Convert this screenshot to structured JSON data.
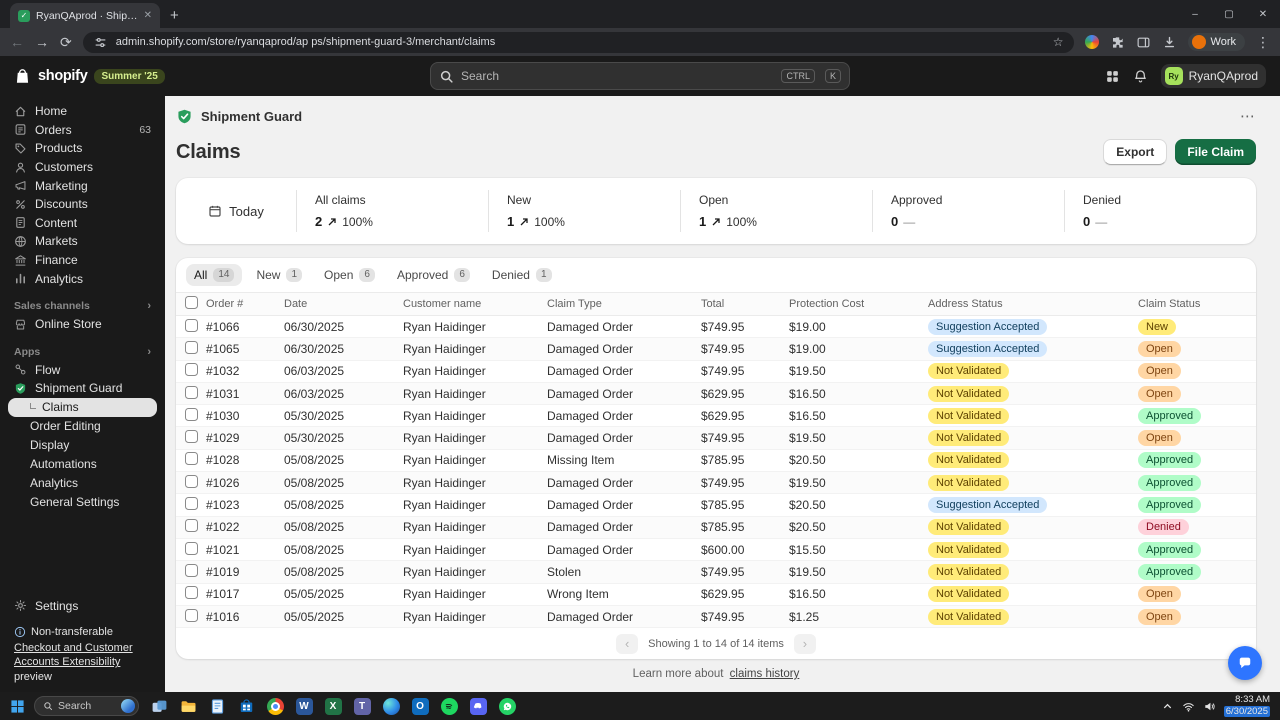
{
  "colors": {
    "brand-green": "#2a9d5c",
    "button-green": "#166e44",
    "badge-blue-bg": "#d2e7fd",
    "badge-blue-text": "#12405e",
    "badge-yellow-bg": "#ffeb79",
    "badge-yellow-text": "#5e4200",
    "badge-orange-bg": "#ffd6a4",
    "badge-orange-text": "#7e4410",
    "badge-green-bg": "#b0fcc8",
    "badge-green-text": "#0c5132",
    "badge-red-bg": "#fed1da",
    "badge-red-text": "#8e0b21",
    "chat-blue": "#2e75ff"
  },
  "browser": {
    "tab_title": "RyanQAprod · Shipment Guard",
    "url": "admin.shopify.com/store/ryanqaprod/ap ps/shipment-guard-3/merchant/claims",
    "profile_label": "Work"
  },
  "topbar": {
    "wordmark": "shopify",
    "edition_badge": "Summer '25",
    "search_placeholder": "Search",
    "shortcut_keys": [
      "CTRL",
      "K"
    ],
    "avatar_initials": "Ry",
    "account_name": "RyanQAprod"
  },
  "sidebar": {
    "items": [
      {
        "label": "Home",
        "icon": "home-icon"
      },
      {
        "label": "Orders",
        "icon": "orders-icon",
        "badge": "63"
      },
      {
        "label": "Products",
        "icon": "products-icon"
      },
      {
        "label": "Customers",
        "icon": "customers-icon"
      },
      {
        "label": "Marketing",
        "icon": "marketing-icon"
      },
      {
        "label": "Discounts",
        "icon": "discounts-icon"
      },
      {
        "label": "Content",
        "icon": "content-icon"
      },
      {
        "label": "Markets",
        "icon": "markets-icon"
      },
      {
        "label": "Finance",
        "icon": "finance-icon"
      },
      {
        "label": "Analytics",
        "icon": "analytics-icon"
      }
    ],
    "sales_channels_header": "Sales channels",
    "sales_channel_items": [
      {
        "label": "Online Store",
        "icon": "online-store-icon"
      }
    ],
    "apps_header": "Apps",
    "app_items": [
      {
        "label": "Flow",
        "icon": "flow-icon"
      },
      {
        "label": "Shipment Guard",
        "icon": "shipment-guard-icon",
        "children": [
          {
            "label": "Claims",
            "active": true
          },
          {
            "label": "Order Editing"
          },
          {
            "label": "Display"
          },
          {
            "label": "Automations"
          },
          {
            "label": "Analytics"
          },
          {
            "label": "General Settings"
          }
        ]
      }
    ],
    "settings_label": "Settings",
    "notice": {
      "title": "Non-transferable",
      "link_text": "Checkout and Customer Accounts Extensibility",
      "suffix": "preview"
    }
  },
  "main": {
    "app_title": "Shipment Guard",
    "page_title": "Claims",
    "export_button": "Export",
    "file_claim_button": "File Claim",
    "date_filter": "Today",
    "stats": [
      {
        "label": "All claims",
        "value": "2",
        "change": "100%",
        "trend": "up"
      },
      {
        "label": "New",
        "value": "1",
        "change": "100%",
        "trend": "up"
      },
      {
        "label": "Open",
        "value": "1",
        "change": "100%",
        "trend": "up"
      },
      {
        "label": "Approved",
        "value": "0",
        "change": "—",
        "trend": "flat"
      },
      {
        "label": "Denied",
        "value": "0",
        "change": "—",
        "trend": "flat"
      }
    ],
    "filter_tabs": [
      {
        "label": "All",
        "count": "14",
        "active": true
      },
      {
        "label": "New",
        "count": "1"
      },
      {
        "label": "Open",
        "count": "6"
      },
      {
        "label": "Approved",
        "count": "6"
      },
      {
        "label": "Denied",
        "count": "1"
      }
    ],
    "table": {
      "columns": [
        "Order #",
        "Date",
        "Customer name",
        "Claim Type",
        "Total",
        "Protection Cost",
        "Address Status",
        "Claim Status"
      ],
      "rows": [
        {
          "order": "#1066",
          "date": "06/30/2025",
          "customer": "Ryan Haidinger",
          "claim_type": "Damaged Order",
          "total": "$749.95",
          "protection_cost": "$19.00",
          "address_status": "Suggestion Accepted",
          "claim_status": "New"
        },
        {
          "order": "#1065",
          "date": "06/30/2025",
          "customer": "Ryan Haidinger",
          "claim_type": "Damaged Order",
          "total": "$749.95",
          "protection_cost": "$19.00",
          "address_status": "Suggestion Accepted",
          "claim_status": "Open"
        },
        {
          "order": "#1032",
          "date": "06/03/2025",
          "customer": "Ryan Haidinger",
          "claim_type": "Damaged Order",
          "total": "$749.95",
          "protection_cost": "$19.50",
          "address_status": "Not Validated",
          "claim_status": "Open"
        },
        {
          "order": "#1031",
          "date": "06/03/2025",
          "customer": "Ryan Haidinger",
          "claim_type": "Damaged Order",
          "total": "$629.95",
          "protection_cost": "$16.50",
          "address_status": "Not Validated",
          "claim_status": "Open"
        },
        {
          "order": "#1030",
          "date": "05/30/2025",
          "customer": "Ryan Haidinger",
          "claim_type": "Damaged Order",
          "total": "$629.95",
          "protection_cost": "$16.50",
          "address_status": "Not Validated",
          "claim_status": "Approved"
        },
        {
          "order": "#1029",
          "date": "05/30/2025",
          "customer": "Ryan Haidinger",
          "claim_type": "Damaged Order",
          "total": "$749.95",
          "protection_cost": "$19.50",
          "address_status": "Not Validated",
          "claim_status": "Open"
        },
        {
          "order": "#1028",
          "date": "05/08/2025",
          "customer": "Ryan Haidinger",
          "claim_type": "Missing Item",
          "total": "$785.95",
          "protection_cost": "$20.50",
          "address_status": "Not Validated",
          "claim_status": "Approved"
        },
        {
          "order": "#1026",
          "date": "05/08/2025",
          "customer": "Ryan Haidinger",
          "claim_type": "Damaged Order",
          "total": "$749.95",
          "protection_cost": "$19.50",
          "address_status": "Not Validated",
          "claim_status": "Approved"
        },
        {
          "order": "#1023",
          "date": "05/08/2025",
          "customer": "Ryan Haidinger",
          "claim_type": "Damaged Order",
          "total": "$785.95",
          "protection_cost": "$20.50",
          "address_status": "Suggestion Accepted",
          "claim_status": "Approved"
        },
        {
          "order": "#1022",
          "date": "05/08/2025",
          "customer": "Ryan Haidinger",
          "claim_type": "Damaged Order",
          "total": "$785.95",
          "protection_cost": "$20.50",
          "address_status": "Not Validated",
          "claim_status": "Denied"
        },
        {
          "order": "#1021",
          "date": "05/08/2025",
          "customer": "Ryan Haidinger",
          "claim_type": "Damaged Order",
          "total": "$600.00",
          "protection_cost": "$15.50",
          "address_status": "Not Validated",
          "claim_status": "Approved"
        },
        {
          "order": "#1019",
          "date": "05/08/2025",
          "customer": "Ryan Haidinger",
          "claim_type": "Stolen",
          "total": "$749.95",
          "protection_cost": "$19.50",
          "address_status": "Not Validated",
          "claim_status": "Approved"
        },
        {
          "order": "#1017",
          "date": "05/05/2025",
          "customer": "Ryan Haidinger",
          "claim_type": "Wrong Item",
          "total": "$629.95",
          "protection_cost": "$16.50",
          "address_status": "Not Validated",
          "claim_status": "Open"
        },
        {
          "order": "#1016",
          "date": "05/05/2025",
          "customer": "Ryan Haidinger",
          "claim_type": "Damaged Order",
          "total": "$749.95",
          "protection_cost": "$1.25",
          "address_status": "Not Validated",
          "claim_status": "Open"
        }
      ]
    },
    "status_styles": {
      "Suggestion Accepted": "blue",
      "Not Validated": "yellow",
      "New": "yellow",
      "Open": "orange",
      "Approved": "green",
      "Denied": "red"
    },
    "pagination_text": "Showing 1 to 14 of 14 items",
    "footer_text": "Learn more about",
    "footer_link": "claims history"
  },
  "taskbar": {
    "search_placeholder": "Search",
    "icons": [
      "task-view",
      "file-explorer",
      "notepad",
      "microsoft-store",
      "chrome",
      "word",
      "excel",
      "teams",
      "edge",
      "outlook",
      "spotify",
      "discord",
      "whatsapp"
    ],
    "time": "8:33 AM",
    "date": "6/30/2025"
  }
}
